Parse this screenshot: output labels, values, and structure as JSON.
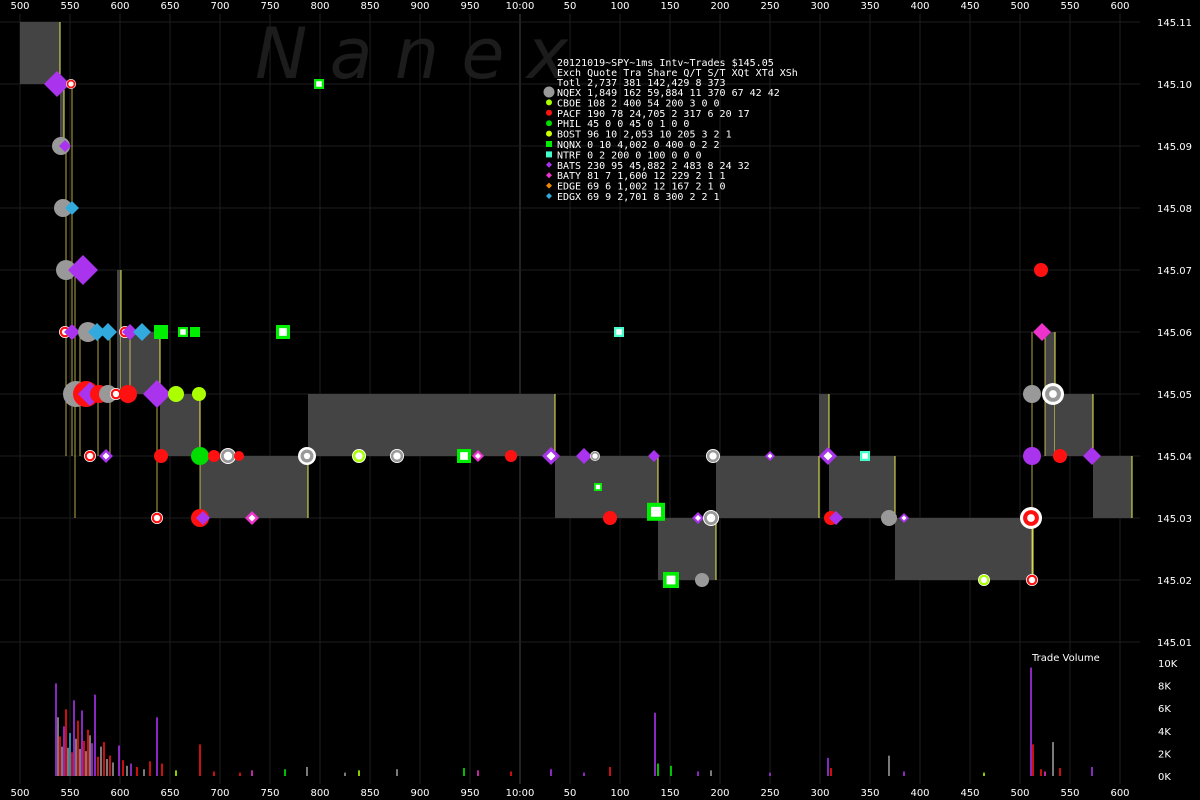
{
  "watermark": "N a n e x",
  "chart_data": {
    "type": "scatter",
    "title": "20121019~SPY~1ms Intv~Trades $145.05",
    "x_ticks": [
      "500",
      "550",
      "600",
      "650",
      "700",
      "750",
      "800",
      "850",
      "900",
      "950",
      "10:00",
      "50",
      "100",
      "150",
      "200",
      "250",
      "300",
      "350",
      "400",
      "450",
      "500",
      "550",
      "600"
    ],
    "x_ticks_bottom": [
      "500",
      "550",
      "600",
      "650",
      "700",
      "750",
      "800",
      "850",
      "900",
      "950",
      "10:00",
      "50",
      "100",
      "150",
      "200",
      "250",
      "300",
      "350",
      "400",
      "450",
      "500",
      "550",
      "600"
    ],
    "y_ticks": [
      "145.11",
      "145.10",
      "145.09",
      "145.08",
      "145.07",
      "145.06",
      "145.05",
      "145.04",
      "145.03",
      "145.02",
      "145.01"
    ],
    "ylim": [
      145.01,
      145.11
    ],
    "volume_title": "Trade Volume",
    "volume_ticks": [
      "10K",
      "8K",
      "6K",
      "4K",
      "2K",
      "0K"
    ],
    "volume_max": 10000,
    "legend_header": "Exch Quote Tra  Share  Q/T   S/T  XQt XTd XSh",
    "legend_total": "Totl 2,737 381 142,429    8   373",
    "legend": [
      {
        "exch": "NQEX",
        "line": "1,849 162  59,884   11   370  67  42  42",
        "color": "#999999",
        "marker": "circle"
      },
      {
        "exch": "CBOE",
        "line": "  108   2     400   54   200   3   0   0",
        "color": "#aaff00",
        "marker": "circle"
      },
      {
        "exch": "PACF",
        "line": "  190  78  24,705    2   317   6  20  17",
        "color": "#ff1111",
        "marker": "circle"
      },
      {
        "exch": "PHIL",
        "line": "   45   0       0   45     0   1   0   0",
        "color": "#00dd00",
        "marker": "circle"
      },
      {
        "exch": "BOST",
        "line": "   96  10   2,053   10   205   3   2   1",
        "color": "#ccff00",
        "marker": "circle"
      },
      {
        "exch": "NQNX",
        "line": "    0  10   4,002    0   400   0   2   2",
        "color": "#00ee00",
        "marker": "square"
      },
      {
        "exch": "NTRF",
        "line": "    0   2     200    0   100   0   0   0",
        "color": "#44ffcc",
        "marker": "square"
      },
      {
        "exch": "BATS",
        "line": "  230  95  45,882    2   483   8  24  32",
        "color": "#aa33ee",
        "marker": "diamond"
      },
      {
        "exch": "BATY",
        "line": "   81   7   1,600   12   229   2   1   1",
        "color": "#ee33cc",
        "marker": "diamond"
      },
      {
        "exch": "EDGE",
        "line": "   69   6   1,002   12   167   2   1   0",
        "color": "#ee8800",
        "marker": "diamond"
      },
      {
        "exch": "EDGX",
        "line": "   69   9   2,701    8   300   2   2   1",
        "color": "#33aadd",
        "marker": "diamond"
      }
    ],
    "nbbo_bands": [
      {
        "x0": 20,
        "x1": 60,
        "bid": 145.1,
        "ask": 145.11
      },
      {
        "x0": 60,
        "x1": 64,
        "bid": 145.09,
        "ask": 145.1
      },
      {
        "x0": 117,
        "x1": 121,
        "bid": 145.05,
        "ask": 145.07
      },
      {
        "x0": 121,
        "x1": 160,
        "bid": 145.05,
        "ask": 145.06
      },
      {
        "x0": 160,
        "x1": 200,
        "bid": 145.04,
        "ask": 145.05
      },
      {
        "x0": 200,
        "x1": 308,
        "bid": 145.03,
        "ask": 145.04
      },
      {
        "x0": 308,
        "x1": 555,
        "bid": 145.04,
        "ask": 145.05
      },
      {
        "x0": 555,
        "x1": 658,
        "bid": 145.03,
        "ask": 145.04
      },
      {
        "x0": 658,
        "x1": 716,
        "bid": 145.02,
        "ask": 145.03
      },
      {
        "x0": 716,
        "x1": 819,
        "bid": 145.03,
        "ask": 145.04
      },
      {
        "x0": 819,
        "x1": 829,
        "bid": 145.04,
        "ask": 145.05
      },
      {
        "x0": 829,
        "x1": 895,
        "bid": 145.03,
        "ask": 145.04
      },
      {
        "x0": 895,
        "x1": 1033,
        "bid": 145.02,
        "ask": 145.03
      },
      {
        "x0": 1045,
        "x1": 1055,
        "bid": 145.04,
        "ask": 145.06
      },
      {
        "x0": 1055,
        "x1": 1093,
        "bid": 145.04,
        "ask": 145.05
      },
      {
        "x0": 1093,
        "x1": 1132,
        "bid": 145.03,
        "ask": 145.04
      }
    ],
    "trades": [
      {
        "x": 57,
        "p": 145.1,
        "c": "#aa33ee",
        "m": "diamond",
        "s": 13
      },
      {
        "x": 71,
        "p": 145.1,
        "c": "#ff1111",
        "m": "ring",
        "s": 5
      },
      {
        "x": 61,
        "p": 145.09,
        "c": "#999999",
        "m": "circle",
        "s": 9
      },
      {
        "x": 65,
        "p": 145.09,
        "c": "#aa33ee",
        "m": "diamond",
        "s": 6
      },
      {
        "x": 63,
        "p": 145.08,
        "c": "#999999",
        "m": "circle",
        "s": 9
      },
      {
        "x": 72,
        "p": 145.08,
        "c": "#33aadd",
        "m": "diamond",
        "s": 7
      },
      {
        "x": 66,
        "p": 145.07,
        "c": "#999999",
        "m": "circle",
        "s": 10
      },
      {
        "x": 83,
        "p": 145.07,
        "c": "#aa33ee",
        "m": "diamond",
        "s": 15
      },
      {
        "x": 65,
        "p": 145.06,
        "c": "#ff1111",
        "m": "ring",
        "s": 6
      },
      {
        "x": 72,
        "p": 145.06,
        "c": "#aa33ee",
        "m": "diamond",
        "s": 8
      },
      {
        "x": 88,
        "p": 145.06,
        "c": "#999999",
        "m": "circle",
        "s": 10
      },
      {
        "x": 97,
        "p": 145.06,
        "c": "#33aadd",
        "m": "diamond",
        "s": 9
      },
      {
        "x": 108,
        "p": 145.06,
        "c": "#33aadd",
        "m": "diamond",
        "s": 9
      },
      {
        "x": 125,
        "p": 145.06,
        "c": "#ff1111",
        "m": "ring",
        "s": 6
      },
      {
        "x": 130,
        "p": 145.06,
        "c": "#aa33ee",
        "m": "diamond",
        "s": 8
      },
      {
        "x": 142,
        "p": 145.06,
        "c": "#33aadd",
        "m": "diamond",
        "s": 9
      },
      {
        "x": 161,
        "p": 145.06,
        "c": "#00ee00",
        "m": "square",
        "s": 7
      },
      {
        "x": 183,
        "p": 145.06,
        "c": "#00ee00",
        "m": "hsquare",
        "s": 5
      },
      {
        "x": 195,
        "p": 145.06,
        "c": "#00ee00",
        "m": "square",
        "s": 5
      },
      {
        "x": 283,
        "p": 145.06,
        "c": "#00ee00",
        "m": "hsquare",
        "s": 7
      },
      {
        "x": 319,
        "p": 145.1,
        "c": "#00ee00",
        "m": "hsquare",
        "s": 5
      },
      {
        "x": 619,
        "p": 145.06,
        "c": "#44ffcc",
        "m": "hsquare",
        "s": 5
      },
      {
        "x": 76,
        "p": 145.05,
        "c": "#999999",
        "m": "circle",
        "s": 13
      },
      {
        "x": 86,
        "p": 145.05,
        "c": "#ff1111",
        "m": "circle",
        "s": 13
      },
      {
        "x": 90,
        "p": 145.05,
        "c": "#aa33ee",
        "m": "diamond",
        "s": 12
      },
      {
        "x": 99,
        "p": 145.05,
        "c": "#ff1111",
        "m": "circle",
        "s": 9
      },
      {
        "x": 108,
        "p": 145.05,
        "c": "#999999",
        "m": "circle",
        "s": 9
      },
      {
        "x": 116,
        "p": 145.05,
        "c": "#ff1111",
        "m": "ring",
        "s": 6
      },
      {
        "x": 128,
        "p": 145.05,
        "c": "#ff1111",
        "m": "circle",
        "s": 9
      },
      {
        "x": 157,
        "p": 145.05,
        "c": "#aa33ee",
        "m": "diamond",
        "s": 14
      },
      {
        "x": 176,
        "p": 145.05,
        "c": "#aaff00",
        "m": "circle",
        "s": 8
      },
      {
        "x": 199,
        "p": 145.05,
        "c": "#aaff00",
        "m": "circle",
        "s": 7
      },
      {
        "x": 90,
        "p": 145.04,
        "c": "#ff1111",
        "m": "ring",
        "s": 6
      },
      {
        "x": 106,
        "p": 145.04,
        "c": "#aa33ee",
        "m": "hdiamond",
        "s": 7
      },
      {
        "x": 161,
        "p": 145.04,
        "c": "#ff1111",
        "m": "circle",
        "s": 7
      },
      {
        "x": 200,
        "p": 145.04,
        "c": "#00dd00",
        "m": "circle",
        "s": 9
      },
      {
        "x": 214,
        "p": 145.04,
        "c": "#ff1111",
        "m": "circle",
        "s": 6
      },
      {
        "x": 228,
        "p": 145.04,
        "c": "#999999",
        "m": "ring",
        "s": 8
      },
      {
        "x": 239,
        "p": 145.04,
        "c": "#ff1111",
        "m": "circle",
        "s": 5
      },
      {
        "x": 307,
        "p": 145.04,
        "c": "#999999",
        "m": "target",
        "s": 9
      },
      {
        "x": 359,
        "p": 145.04,
        "c": "#aaff00",
        "m": "ring",
        "s": 7
      },
      {
        "x": 397,
        "p": 145.04,
        "c": "#999999",
        "m": "ring",
        "s": 7
      },
      {
        "x": 464,
        "p": 145.04,
        "c": "#00ee00",
        "m": "hsquare",
        "s": 7
      },
      {
        "x": 478,
        "p": 145.04,
        "c": "#ee33cc",
        "m": "hdiamond",
        "s": 6
      },
      {
        "x": 511,
        "p": 145.04,
        "c": "#ff1111",
        "m": "circle",
        "s": 6
      },
      {
        "x": 551,
        "p": 145.04,
        "c": "#aa33ee",
        "m": "hdiamond",
        "s": 9
      },
      {
        "x": 584,
        "p": 145.04,
        "c": "#aa33ee",
        "m": "diamond",
        "s": 8
      },
      {
        "x": 595,
        "p": 145.04,
        "c": "#999999",
        "m": "ring",
        "s": 5
      },
      {
        "x": 654,
        "p": 145.04,
        "c": "#aa33ee",
        "m": "diamond",
        "s": 6
      },
      {
        "x": 713,
        "p": 145.04,
        "c": "#999999",
        "m": "ring",
        "s": 7
      },
      {
        "x": 770,
        "p": 145.04,
        "c": "#aa33ee",
        "m": "hdiamond",
        "s": 5
      },
      {
        "x": 828,
        "p": 145.04,
        "c": "#aa33ee",
        "m": "hdiamond",
        "s": 9
      },
      {
        "x": 865,
        "p": 145.04,
        "c": "#44ffcc",
        "m": "hsquare",
        "s": 5
      },
      {
        "x": 1032,
        "p": 145.04,
        "c": "#aa33ee",
        "m": "circle",
        "s": 9
      },
      {
        "x": 1060,
        "p": 145.04,
        "c": "#ff1111",
        "m": "circle",
        "s": 7
      },
      {
        "x": 1092,
        "p": 145.04,
        "c": "#aa33ee",
        "m": "diamond",
        "s": 9
      },
      {
        "x": 598,
        "p": 145.035,
        "c": "#00ee00",
        "m": "hsquare",
        "s": 4
      },
      {
        "x": 157,
        "p": 145.03,
        "c": "#ff1111",
        "m": "ring",
        "s": 6
      },
      {
        "x": 200,
        "p": 145.03,
        "c": "#ff1111",
        "m": "circle",
        "s": 9
      },
      {
        "x": 203,
        "p": 145.03,
        "c": "#aa33ee",
        "m": "diamond",
        "s": 7
      },
      {
        "x": 252,
        "p": 145.03,
        "c": "#ee33cc",
        "m": "hdiamond",
        "s": 7
      },
      {
        "x": 610,
        "p": 145.03,
        "c": "#ff1111",
        "m": "circle",
        "s": 7
      },
      {
        "x": 656,
        "p": 145.031,
        "c": "#00ee00",
        "m": "hsquare",
        "s": 9
      },
      {
        "x": 698,
        "p": 145.03,
        "c": "#aa33ee",
        "m": "hdiamond",
        "s": 6
      },
      {
        "x": 711,
        "p": 145.03,
        "c": "#999999",
        "m": "ring",
        "s": 8
      },
      {
        "x": 831,
        "p": 145.03,
        "c": "#ff1111",
        "m": "circle",
        "s": 7
      },
      {
        "x": 836,
        "p": 145.03,
        "c": "#aa33ee",
        "m": "diamond",
        "s": 7
      },
      {
        "x": 889,
        "p": 145.03,
        "c": "#999999",
        "m": "circle",
        "s": 8
      },
      {
        "x": 904,
        "p": 145.03,
        "c": "#aa33ee",
        "m": "hdiamond",
        "s": 5
      },
      {
        "x": 1031,
        "p": 145.03,
        "c": "#ff1111",
        "m": "target",
        "s": 11
      },
      {
        "x": 671,
        "p": 145.02,
        "c": "#00ee00",
        "m": "hsquare",
        "s": 8
      },
      {
        "x": 702,
        "p": 145.02,
        "c": "#999999",
        "m": "circle",
        "s": 7
      },
      {
        "x": 984,
        "p": 145.02,
        "c": "#aaff00",
        "m": "ring",
        "s": 6
      },
      {
        "x": 1032,
        "p": 145.02,
        "c": "#ff1111",
        "m": "ring",
        "s": 6
      },
      {
        "x": 1041,
        "p": 145.07,
        "c": "#ff1111",
        "m": "circle",
        "s": 7
      },
      {
        "x": 1042,
        "p": 145.06,
        "c": "#ee33cc",
        "m": "diamond",
        "s": 9
      },
      {
        "x": 1032,
        "p": 145.05,
        "c": "#999999",
        "m": "circle",
        "s": 9
      },
      {
        "x": 1053,
        "p": 145.05,
        "c": "#999999",
        "m": "target",
        "s": 11
      }
    ],
    "volume_bars": [
      {
        "x": 56,
        "v": 8200,
        "c": "#aa33ee"
      },
      {
        "x": 58,
        "v": 5200,
        "c": "#999999"
      },
      {
        "x": 60,
        "v": 3500,
        "c": "#ff1111"
      },
      {
        "x": 62,
        "v": 2600,
        "c": "#999999"
      },
      {
        "x": 64,
        "v": 4400,
        "c": "#aa33ee"
      },
      {
        "x": 66,
        "v": 5900,
        "c": "#ff1111"
      },
      {
        "x": 68,
        "v": 2500,
        "c": "#999999"
      },
      {
        "x": 70,
        "v": 3800,
        "c": "#33aadd"
      },
      {
        "x": 72,
        "v": 2100,
        "c": "#ff1111"
      },
      {
        "x": 74,
        "v": 6700,
        "c": "#aa33ee"
      },
      {
        "x": 76,
        "v": 3300,
        "c": "#999999"
      },
      {
        "x": 78,
        "v": 4900,
        "c": "#ff1111"
      },
      {
        "x": 80,
        "v": 2400,
        "c": "#999999"
      },
      {
        "x": 82,
        "v": 5800,
        "c": "#aa33ee"
      },
      {
        "x": 84,
        "v": 3100,
        "c": "#ff1111"
      },
      {
        "x": 86,
        "v": 2200,
        "c": "#999999"
      },
      {
        "x": 88,
        "v": 4100,
        "c": "#ff1111"
      },
      {
        "x": 90,
        "v": 3600,
        "c": "#999999"
      },
      {
        "x": 92,
        "v": 2900,
        "c": "#aa33ee"
      },
      {
        "x": 95,
        "v": 7200,
        "c": "#aa33ee"
      },
      {
        "x": 98,
        "v": 1700,
        "c": "#ff1111"
      },
      {
        "x": 101,
        "v": 2600,
        "c": "#999999"
      },
      {
        "x": 104,
        "v": 3000,
        "c": "#ff1111"
      },
      {
        "x": 107,
        "v": 1500,
        "c": "#999999"
      },
      {
        "x": 110,
        "v": 1800,
        "c": "#ff1111"
      },
      {
        "x": 113,
        "v": 1200,
        "c": "#999999"
      },
      {
        "x": 119,
        "v": 2700,
        "c": "#aa33ee"
      },
      {
        "x": 123,
        "v": 1400,
        "c": "#ff1111"
      },
      {
        "x": 127,
        "v": 900,
        "c": "#999999"
      },
      {
        "x": 131,
        "v": 1100,
        "c": "#aa33ee"
      },
      {
        "x": 137,
        "v": 800,
        "c": "#ff1111"
      },
      {
        "x": 144,
        "v": 600,
        "c": "#999999"
      },
      {
        "x": 150,
        "v": 1300,
        "c": "#ff1111"
      },
      {
        "x": 157,
        "v": 5200,
        "c": "#aa33ee"
      },
      {
        "x": 162,
        "v": 1100,
        "c": "#ff1111"
      },
      {
        "x": 176,
        "v": 500,
        "c": "#aaff00"
      },
      {
        "x": 200,
        "v": 2800,
        "c": "#ff1111"
      },
      {
        "x": 214,
        "v": 400,
        "c": "#ff1111"
      },
      {
        "x": 240,
        "v": 300,
        "c": "#ff1111"
      },
      {
        "x": 252,
        "v": 500,
        "c": "#ee33cc"
      },
      {
        "x": 285,
        "v": 600,
        "c": "#00ee00"
      },
      {
        "x": 307,
        "v": 800,
        "c": "#999999"
      },
      {
        "x": 345,
        "v": 300,
        "c": "#999999"
      },
      {
        "x": 359,
        "v": 500,
        "c": "#aaff00"
      },
      {
        "x": 397,
        "v": 600,
        "c": "#999999"
      },
      {
        "x": 464,
        "v": 700,
        "c": "#00ee00"
      },
      {
        "x": 478,
        "v": 500,
        "c": "#ee33cc"
      },
      {
        "x": 511,
        "v": 400,
        "c": "#ff1111"
      },
      {
        "x": 551,
        "v": 600,
        "c": "#aa33ee"
      },
      {
        "x": 584,
        "v": 300,
        "c": "#aa33ee"
      },
      {
        "x": 610,
        "v": 800,
        "c": "#ff1111"
      },
      {
        "x": 655,
        "v": 5600,
        "c": "#aa33ee"
      },
      {
        "x": 658,
        "v": 1100,
        "c": "#00ee00"
      },
      {
        "x": 671,
        "v": 900,
        "c": "#00ee00"
      },
      {
        "x": 698,
        "v": 400,
        "c": "#aa33ee"
      },
      {
        "x": 711,
        "v": 500,
        "c": "#999999"
      },
      {
        "x": 770,
        "v": 300,
        "c": "#aa33ee"
      },
      {
        "x": 828,
        "v": 1600,
        "c": "#aa33ee"
      },
      {
        "x": 831,
        "v": 700,
        "c": "#ff1111"
      },
      {
        "x": 889,
        "v": 1800,
        "c": "#999999"
      },
      {
        "x": 904,
        "v": 400,
        "c": "#aa33ee"
      },
      {
        "x": 984,
        "v": 300,
        "c": "#aaff00"
      },
      {
        "x": 1031,
        "v": 9600,
        "c": "#aa33ee"
      },
      {
        "x": 1033,
        "v": 2800,
        "c": "#ff1111"
      },
      {
        "x": 1041,
        "v": 600,
        "c": "#ff1111"
      },
      {
        "x": 1045,
        "v": 400,
        "c": "#ee33cc"
      },
      {
        "x": 1053,
        "v": 3000,
        "c": "#999999"
      },
      {
        "x": 1060,
        "v": 700,
        "c": "#ff1111"
      },
      {
        "x": 1092,
        "v": 800,
        "c": "#aa33ee"
      }
    ]
  }
}
